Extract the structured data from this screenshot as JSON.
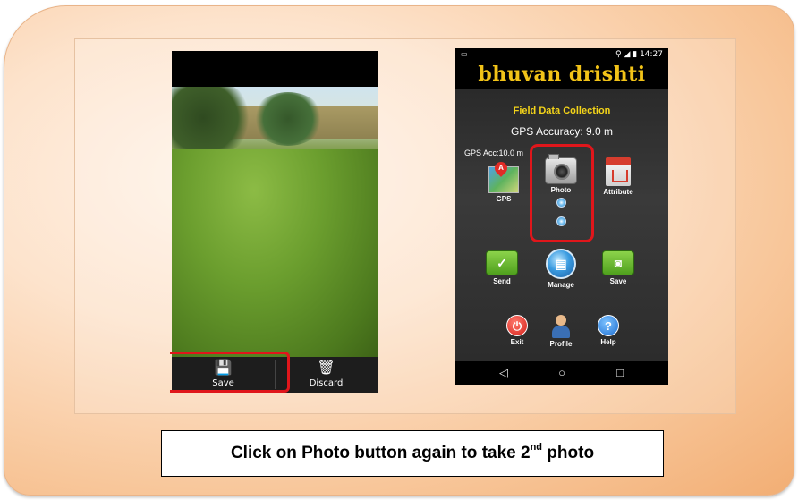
{
  "left_screen": {
    "save_label": "Save",
    "discard_label": "Discard"
  },
  "right_screen": {
    "status_time": "14:27",
    "app_logo": "bhuvan drishti",
    "heading": "Field Data Collection",
    "gps_accuracy": "GPS Accuracy: 9.0 m",
    "gps_acc_small": "GPS Acc:10.0 m",
    "tiles": {
      "gps": "GPS",
      "photo": "Photo",
      "attribute": "Attribute",
      "send": "Send",
      "manage": "Manage",
      "save": "Save",
      "exit": "Exit",
      "profile": "Profile",
      "help": "Help"
    },
    "nav": {
      "back": "◁",
      "home": "○",
      "recents": "□"
    }
  },
  "caption": {
    "text_before": "Click on Photo button again to take 2",
    "superscript": "nd",
    "text_after": " photo"
  },
  "colors": {
    "highlight": "#e0161b",
    "heading_yellow": "#f4d419",
    "logo_gold": "#f2c318"
  }
}
